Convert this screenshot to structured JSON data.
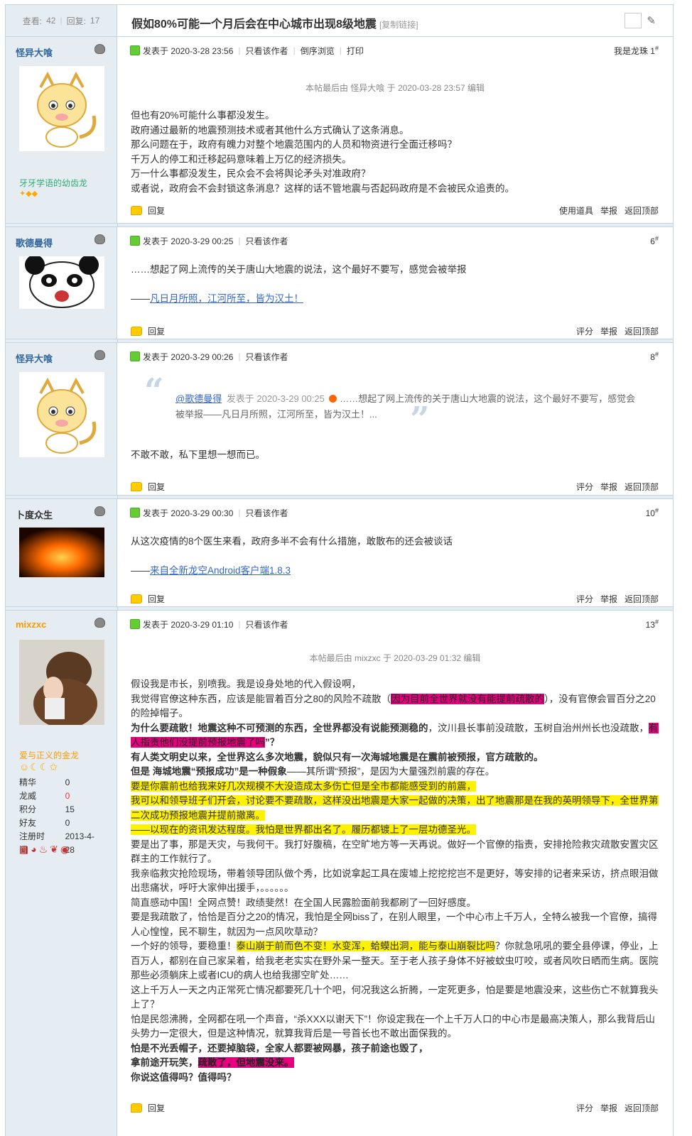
{
  "header": {
    "views_label": "查看:",
    "views": "42",
    "replies_label": "回复:",
    "replies": "17",
    "title": "假如80%可能一个月后会在中心城市出现8级地震",
    "copy_link": "[复制链接]"
  },
  "posts": [
    {
      "user": "怪异大喰",
      "posted": "发表于 2020-3-28 23:56",
      "only_author": "只看该作者",
      "reverse": "倒序浏览",
      "print": "打印",
      "floor_name": "我是龙珠",
      "floor": "1",
      "edited": "本帖最后由 怪异大喰 于 2020-03-28 23:57 编辑",
      "grade": "牙牙学语的幼齿龙",
      "lines": [
        "但也有20%可能什么事都没发生。",
        "政府通过最新的地震预测技术或者其他什么方式确认了这条消息。",
        "那么问题在于，政府有魄力对整个地震范围内的人员和物资进行全面迁移吗？",
        "千万人的停工和迁移起码意味着上万亿的经济损失。",
        "万一什么事都没发生，民众会不会将舆论矛头对准政府？",
        "或者说，政府会不会封锁这条消息？这样的话不管地震与否起码政府是不会被民众追责的。"
      ],
      "reply": "回复",
      "tools": [
        "使用道具",
        "举报",
        "返回顶部"
      ]
    },
    {
      "user": "歌德曼得",
      "posted": "发表于 2020-3-29 00:25",
      "only_author": "只看该作者",
      "floor": "6",
      "text": "……想起了网上流传的关于唐山大地震的说法，这个最好不要写，感觉会被举报",
      "sig_prefix": "——",
      "sig": "凡日月所照，江河所至，皆为汉土！",
      "reply": "回复",
      "tools": [
        "评分",
        "举报",
        "返回顶部"
      ]
    },
    {
      "user": "怪异大喰",
      "posted": "发表于 2020-3-29 00:26",
      "only_author": "只看该作者",
      "floor": "8",
      "quote_user": "@歌德曼得",
      "quote_time": "发表于 2020-3-29 00:25",
      "quote_text": "……想起了网上流传的关于唐山大地震的说法，这个最好不要写，感觉会被举报——凡日月所照，江河所至，皆为汉土！...",
      "text": "不敢不敢，私下里想一想而已。",
      "reply": "回复",
      "tools": [
        "评分",
        "举报",
        "返回顶部"
      ]
    },
    {
      "user": "卜度众生",
      "posted": "发表于 2020-3-29 00:30",
      "only_author": "只看该作者",
      "floor": "10",
      "text": "从这次疫情的8个医生来看，政府多半不会有什么措施，敢散布的还会被谈话",
      "sig_prefix": "——",
      "sig": "来自全新龙空Android客户端1.8.3",
      "reply": "回复",
      "tools": [
        "评分",
        "举报",
        "返回顶部"
      ]
    },
    {
      "user": "mixzxc",
      "posted": "发表于 2020-3-29 01:10",
      "only_author": "只看该作者",
      "floor": "13",
      "edited": "本帖最后由 mixzxc 于 2020-03-29 01:32 编辑",
      "grade": "爱与正义的金龙",
      "stats": [
        [
          "精华",
          "0"
        ],
        [
          "龙威",
          "0"
        ],
        [
          "积分",
          "15"
        ],
        [
          "好友",
          "0"
        ],
        [
          "注册时间",
          "2013-4-28"
        ]
      ],
      "reply": "回复",
      "tools": [
        "评分",
        "举报",
        "返回顶部"
      ],
      "t": {
        "a1": "假设我是市长，别喷我。我是设身处地的代入假设啊，",
        "a2": "我觉得官僚这种东西，应该是能冒着百分之80的风险不疏散（",
        "a2h": "因为目前全世界就没有能提前疏散的",
        "a2e": "），没有官僚会冒百分之20的险掉帽子。",
        "a3b": "为什么要疏散！地震这种不可预测的东西，全世界都没有说能预测稳的",
        "a3": "，汶川县长事前没疏散，玉树自治州州长也没疏散，",
        "a3h": "有人指责他们没提前预报地震了吗",
        "a3e": "”？",
        "a4": "有人类文明史以来，全世界这么多次地震，貌似只有一次海城地震是在震前被预报，官方疏散的。",
        "a5b": "但是 海城地震“预报成功”是一种假象",
        "a5": "——其所谓“预报”，是因为大量强烈前震的存在。",
        "a6": "要是你震前也给我来好几次规模不大没造成太多伤亡但是全市都能感受到的前震，",
        "a7": "我可以和领导班子们开会，讨论要不要疏散，这样没出地震是大家一起做的决策，出了地震那是在我的英明领导下，全世界第二次成功预报地震并提前撤离。",
        "a8": "——以现在的资讯发达程度。我怕是世界都出名了。履历都镀上了一层功德圣光。",
        "a9": "要是出了事，那是天灾，与我何干。我打好腹稿，在空旷地方等一天再说。做好一个官僚的指责，安排抢险救灾疏散安置灾区群主的工作就行了。",
        "a10": "我亲临救灾抢险现场，带着领导团队做个秀，比如说拿起工具在废墟上挖挖挖岂不是更好，等安排的记者来采访，挤点眼泪做出悲痛状，呼吁大家伸出援手，。。。。。。",
        "a11": "简直感动中国！全网点赞！政绩斐然！在全国人民露脸面前我都刷了一回好感度。",
        "a12": "要是我疏散了，恰恰是百分之20的情况，我怕是全网biss了，在别人眼里，一个中心市上千万人，全特么被我一个官僚，搞得人心惶惶，民不聊生，就因为一点风吹草动？",
        "a13": "一个好的领导，要稳重！",
        "a13h": "泰山崩于前而色不变！水变浑，蛤蟆出洞，能与泰山崩裂比吗",
        "a13e": "？你就急吼吼的要全县停课，停业，上百万人，都别在自己家呆着，给我老老实实在野外呆一整天。至于老人孩子身体不好被蚊虫叮咬，或者风吹日晒而生病。医院那些必须躺床上或者ICU的病人也给我挪空旷处……",
        "a14": "这上千万人一天之内正常死亡情况都要死几十个吧，何况我这么折腾，一定死更多，怕是要是地震没来，这些伤亡不就算我头上了？",
        "a15": "怕是民怨沸腾，全网都在吼一个声音，“杀XXX以谢天下”！你设定我在一个上千万人口的中心市是最高决策人，那么我背后山头势力一定很大，但是这种情况，就算我背后是一号首长也不敢出面保我的。",
        "a16": "怕是不光丢帽子，还要掉脑袋，全家人都要被网暴，孩子前途也毁了，",
        "a17": "拿前途开玩笑，",
        "a17h": "疏散了，但地震没来。",
        "a18": "你说这值得吗？值得吗？"
      }
    }
  ],
  "colors": {
    "border": "#c2d5e3",
    "side_bg": "#e5edf2",
    "link": "#3366cc",
    "magenta": "#e6007e",
    "yellow": "#fff200"
  }
}
